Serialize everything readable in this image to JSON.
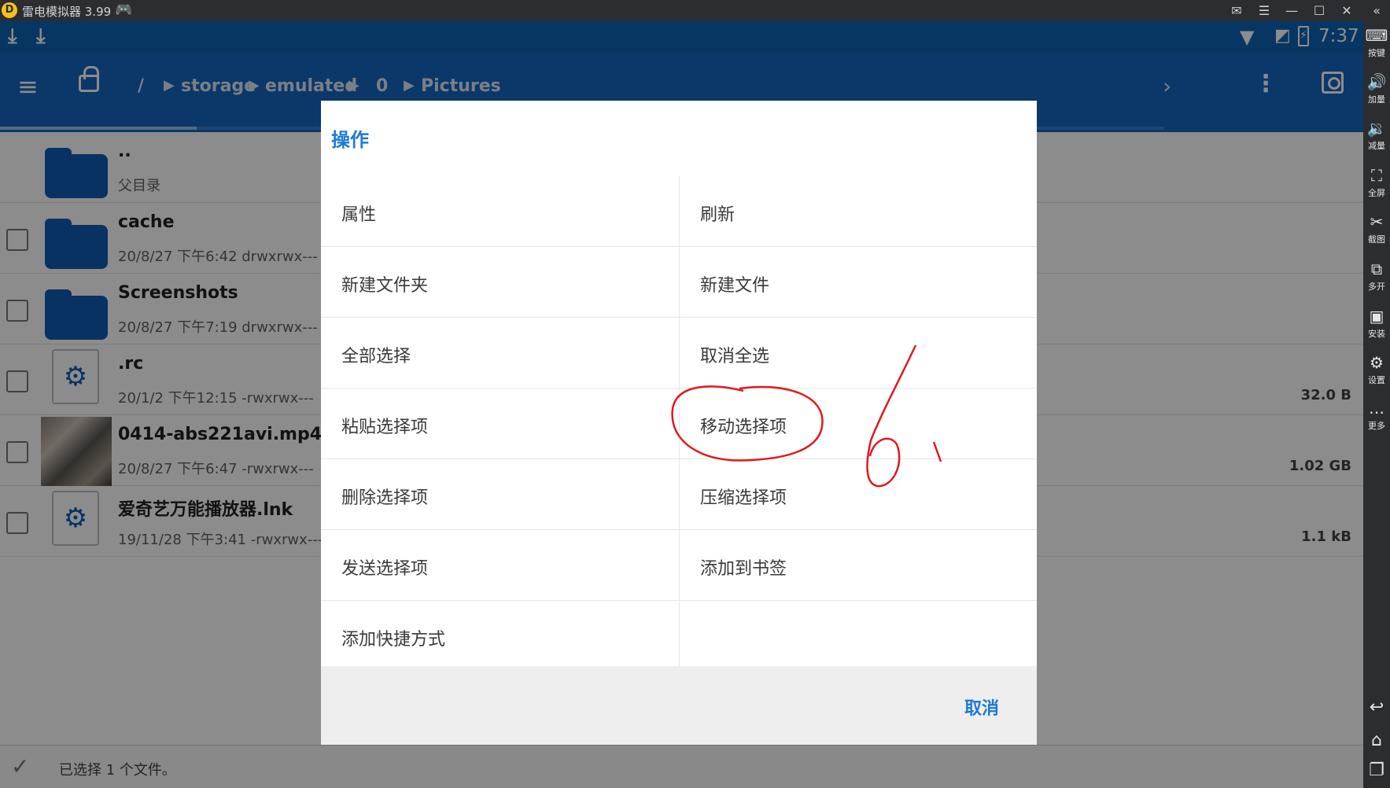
{
  "window": {
    "title": "雷电模拟器 3.99",
    "logo_text": "D",
    "buttons": {
      "mail": "✉",
      "menu": "☰",
      "minimize": "—",
      "maximize": "☐",
      "close": "✕",
      "collapse": "«"
    }
  },
  "sidebar": {
    "items": [
      {
        "icon": "⌨",
        "label": "按键"
      },
      {
        "icon": "🔊",
        "label": "加量"
      },
      {
        "icon": "🔉",
        "label": "减量"
      },
      {
        "icon": "⛶",
        "label": "全屏"
      },
      {
        "icon": "✂",
        "label": "截图"
      },
      {
        "icon": "⧉",
        "label": "多开"
      },
      {
        "icon": "▣",
        "label": "安装"
      },
      {
        "icon": "⚙",
        "label": "设置"
      },
      {
        "icon": "…",
        "label": "更多"
      }
    ],
    "nav": {
      "back": "↩",
      "home": "⌂",
      "recents": "❐"
    }
  },
  "statusbar": {
    "time": "7:37",
    "battery_glyph": "⚡",
    "download_glyph": "⤓"
  },
  "toolbar": {
    "breadcrumb": [
      "/",
      "storage",
      "emulated",
      "0",
      "Pictures"
    ]
  },
  "files": [
    {
      "name": "..",
      "meta": "父目录",
      "size": "",
      "type": "folder",
      "checkbox": false
    },
    {
      "name": "cache",
      "meta": "20/8/27 下午6:42  drwxrwx---",
      "size": "",
      "type": "folder",
      "checkbox": true
    },
    {
      "name": "Screenshots",
      "meta": "20/8/27 下午7:19  drwxrwx---",
      "size": "",
      "type": "folder",
      "checkbox": true
    },
    {
      "name": ".rc",
      "meta": "20/1/2 下午12:15  -rwxrwx---",
      "size": "32.0 B",
      "type": "file",
      "checkbox": true
    },
    {
      "name": "0414-abs221avi.mp4",
      "meta": "20/8/27 下午6:47  -rwxrwx---",
      "size": "1.02 GB",
      "type": "video",
      "checkbox": true
    },
    {
      "name": "爱奇艺万能播放器.lnk",
      "meta": "19/11/28 下午3:41  -rwxrwx---",
      "size": "1.1 kB",
      "type": "file",
      "checkbox": true
    }
  ],
  "bottombar": {
    "message": "已选择 1 个文件。"
  },
  "dialog": {
    "title": "操作",
    "actions": [
      [
        "属性",
        "刷新"
      ],
      [
        "新建文件夹",
        "新建文件"
      ],
      [
        "全部选择",
        "取消全选"
      ],
      [
        "粘贴选择项",
        "移动选择项"
      ],
      [
        "删除选择项",
        "压缩选择项"
      ],
      [
        "发送选择项",
        "添加到书签"
      ],
      [
        "添加快捷方式",
        ""
      ]
    ],
    "cancel": "取消"
  },
  "annotation": {
    "color": "#e0191e",
    "circled_action": "移动选择项",
    "handwritten_text": "6."
  }
}
